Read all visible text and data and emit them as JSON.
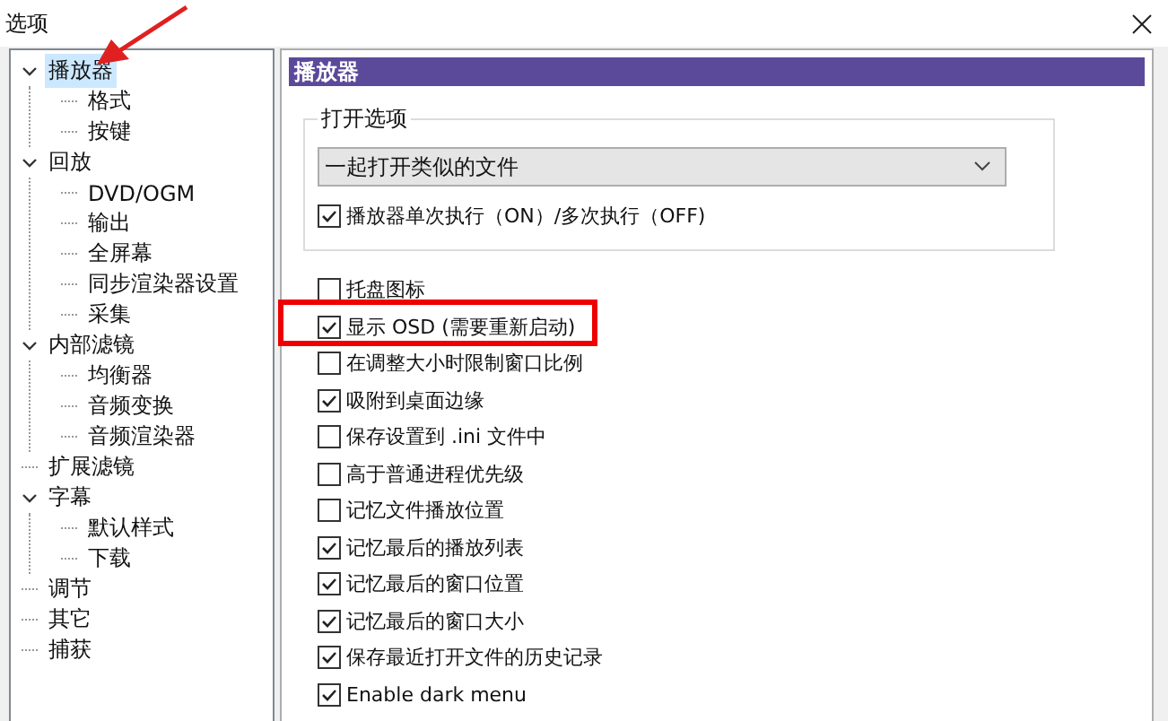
{
  "window": {
    "title": "选项"
  },
  "tree": [
    {
      "label": "播放器",
      "selected": true,
      "expanded": true,
      "children": [
        {
          "label": "格式",
          "selected": false
        },
        {
          "label": "按键",
          "selected": false
        }
      ]
    },
    {
      "label": "回放",
      "selected": false,
      "expanded": true,
      "children": [
        {
          "label": "DVD/OGM",
          "selected": false
        },
        {
          "label": "输出",
          "selected": false
        },
        {
          "label": "全屏幕",
          "selected": false
        },
        {
          "label": "同步渲染器设置",
          "selected": false
        },
        {
          "label": "采集",
          "selected": false
        }
      ]
    },
    {
      "label": "内部滤镜",
      "selected": false,
      "expanded": true,
      "children": [
        {
          "label": "均衡器",
          "selected": false
        },
        {
          "label": "音频变换",
          "selected": false
        },
        {
          "label": "音频渲染器",
          "selected": false
        }
      ]
    },
    {
      "label": "扩展滤镜",
      "selected": false
    },
    {
      "label": "字幕",
      "selected": false,
      "expanded": true,
      "children": [
        {
          "label": "默认样式",
          "selected": false
        },
        {
          "label": "下载",
          "selected": false
        }
      ]
    },
    {
      "label": "调节",
      "selected": false
    },
    {
      "label": "其它",
      "selected": false
    },
    {
      "label": "捕获",
      "selected": false
    }
  ],
  "panel": {
    "title": "播放器",
    "group": {
      "title": "打开选项",
      "dropdown": {
        "value": "一起打开类似的文件"
      },
      "option": {
        "label": "播放器单次执行（ON）/多次执行（OFF)",
        "checked": true
      }
    },
    "options": [
      {
        "label": "托盘图标",
        "checked": false
      },
      {
        "label": "显示 OSD (需要重新启动)",
        "checked": true
      },
      {
        "label": "在调整大小时限制窗口比例",
        "checked": false
      },
      {
        "label": "吸附到桌面边缘",
        "checked": true
      },
      {
        "label": "保存设置到 .ini 文件中",
        "checked": false
      },
      {
        "label": "高于普通进程优先级",
        "checked": false
      },
      {
        "label": "记忆文件播放位置",
        "checked": false
      },
      {
        "label": "记忆最后的播放列表",
        "checked": true
      },
      {
        "label": "记忆最后的窗口位置",
        "checked": true
      },
      {
        "label": "记忆最后的窗口大小",
        "checked": true
      },
      {
        "label": "保存最近打开文件的历史记录",
        "checked": true
      },
      {
        "label": "Enable dark menu",
        "checked": true
      }
    ]
  }
}
